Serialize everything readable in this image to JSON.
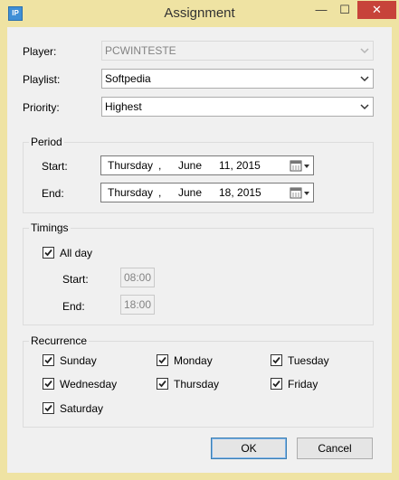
{
  "window": {
    "title": "Assignment",
    "icon_text": "IP",
    "minimize": "—",
    "maximize": "☐",
    "close": "✕"
  },
  "fields": {
    "player_label": "Player:",
    "player_value": "PCWINTESTE",
    "playlist_label": "Playlist:",
    "playlist_value": "Softpedia",
    "priority_label": "Priority:",
    "priority_value": "Highest"
  },
  "period": {
    "title": "Period",
    "start_label": "Start:",
    "start": {
      "weekday": "Thursday",
      "sep": ",",
      "month": "June",
      "day_year": "11, 2015"
    },
    "end_label": "End:",
    "end": {
      "weekday": "Thursday",
      "sep": ",",
      "month": "June",
      "day_year": "18, 2015"
    }
  },
  "timings": {
    "title": "Timings",
    "all_day_label": "All day",
    "all_day_checked": true,
    "start_label": "Start:",
    "start_value": "08:00",
    "end_label": "End:",
    "end_value": "18:00"
  },
  "recurrence": {
    "title": "Recurrence",
    "days": [
      {
        "label": "Sunday",
        "checked": true
      },
      {
        "label": "Monday",
        "checked": true
      },
      {
        "label": "Tuesday",
        "checked": true
      },
      {
        "label": "Wednesday",
        "checked": true
      },
      {
        "label": "Thursday",
        "checked": true
      },
      {
        "label": "Friday",
        "checked": true
      },
      {
        "label": "Saturday",
        "checked": true
      }
    ]
  },
  "buttons": {
    "ok": "OK",
    "cancel": "Cancel"
  },
  "watermark": "SOFTPEDIA",
  "colors": {
    "titlebar": "#efe3a3",
    "close": "#c7433a",
    "default_button_border": "#3c7fb1"
  }
}
